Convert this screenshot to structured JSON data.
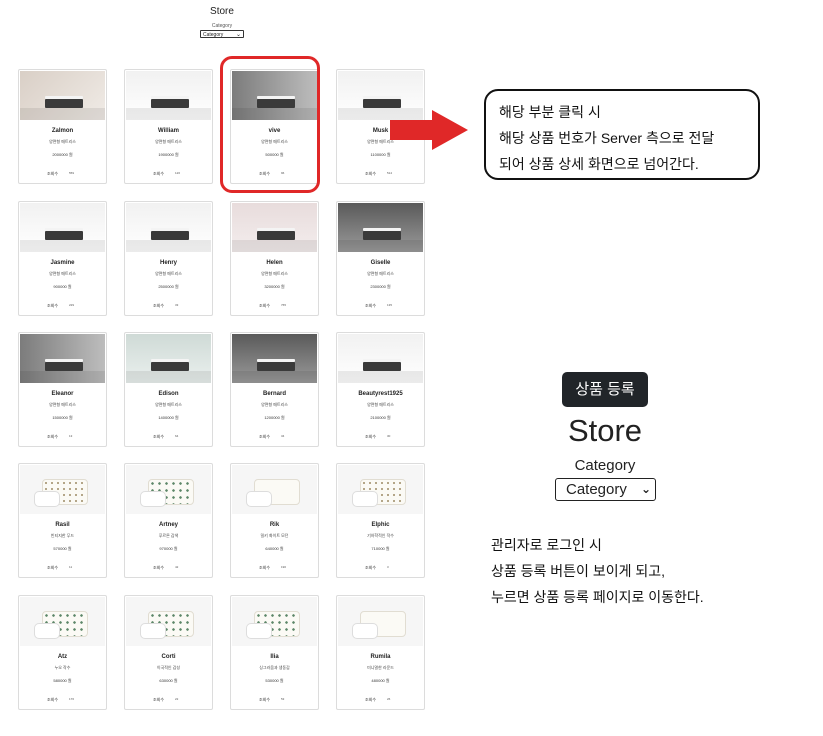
{
  "store_header": {
    "title": "Store",
    "category_label": "Category",
    "category_select": "Category"
  },
  "products": [
    {
      "name": "Zalmon",
      "sub": "양면형 매트리스",
      "price": "2000000 원",
      "views_label": "조회수",
      "views": "559",
      "kind": "mattress",
      "tone": "warm"
    },
    {
      "name": "William",
      "sub": "양면형 매트리스",
      "price": "1900000 원",
      "views_label": "조회수",
      "views": "126",
      "kind": "mattress",
      "tone": "white"
    },
    {
      "name": "vive",
      "sub": "양면형 매트리스",
      "price": "500000 원",
      "views_label": "조회수",
      "views": "96",
      "kind": "mattress",
      "tone": "gray"
    },
    {
      "name": "Musk",
      "sub": "양면형 매트리스",
      "price": "1100000 원",
      "views_label": "조회수",
      "views": "514",
      "kind": "mattress",
      "tone": "white"
    },
    {
      "name": "Jasmine",
      "sub": "양면형 매트리스",
      "price": "900000 원",
      "views_label": "조회수",
      "views": "229",
      "kind": "mattress",
      "tone": "white"
    },
    {
      "name": "Henry",
      "sub": "양면형 매트리스",
      "price": "2500000 원",
      "views_label": "조회수",
      "views": "33",
      "kind": "mattress",
      "tone": "white"
    },
    {
      "name": "Helen",
      "sub": "양면형 매트리스",
      "price": "3200000 원",
      "views_label": "조회수",
      "views": "765",
      "kind": "mattress",
      "tone": "pink"
    },
    {
      "name": "Giselle",
      "sub": "양면형 매트리스",
      "price": "2300000 원",
      "views_label": "조회수",
      "views": "135",
      "kind": "mattress",
      "tone": "dark"
    },
    {
      "name": "Eleanor",
      "sub": "양면형 매트리스",
      "price": "1500000 원",
      "views_label": "조회수",
      "views": "13",
      "kind": "mattress",
      "tone": "gray"
    },
    {
      "name": "Edison",
      "sub": "양면형 매트리스",
      "price": "1400000 원",
      "views_label": "조회수",
      "views": "64",
      "kind": "mattress",
      "tone": "mint"
    },
    {
      "name": "Bernard",
      "sub": "양면형 매트리스",
      "price": "1200000 원",
      "views_label": "조회수",
      "views": "34",
      "kind": "mattress",
      "tone": "dark"
    },
    {
      "name": "Beautyrest1925",
      "sub": "양면형 매트리스",
      "price": "2100000 원",
      "views_label": "조회수",
      "views": "30",
      "kind": "mattress",
      "tone": "white"
    },
    {
      "name": "Rasil",
      "sub": "빈티지한 무드",
      "price": "570000 원",
      "views_label": "조회수",
      "views": "11",
      "kind": "bedding",
      "tone": "dots"
    },
    {
      "name": "Artney",
      "sub": "푸르른 감색",
      "price": "970000 원",
      "views_label": "조회수",
      "views": "42",
      "kind": "bedding",
      "tone": "green"
    },
    {
      "name": "Rik",
      "sub": "밀키 화이트 모던",
      "price": "640000 원",
      "views_label": "조회수",
      "views": "190",
      "kind": "bedding",
      "tone": "plain"
    },
    {
      "name": "Elphic",
      "sub": "기하학적인 작수",
      "price": "710000 원",
      "views_label": "조회수",
      "views": "3",
      "kind": "bedding",
      "tone": "dots"
    },
    {
      "name": "Atz",
      "sub": "누오 작수",
      "price": "580000 원",
      "views_label": "조회수",
      "views": "176",
      "kind": "bedding",
      "tone": "green"
    },
    {
      "name": "Corti",
      "sub": "이국적인 감성",
      "price": "630000 원",
      "views_label": "조회수",
      "views": "22",
      "kind": "bedding",
      "tone": "green"
    },
    {
      "name": "Ilia",
      "sub": "싱그러움과 생동감",
      "price": "530000 원",
      "views_label": "조회수",
      "views": "53",
      "kind": "bedding",
      "tone": "green"
    },
    {
      "name": "Rumila",
      "sub": "미니멀한 라운드",
      "price": "480000 원",
      "views_label": "조회수",
      "views": "26",
      "kind": "bedding",
      "tone": "plain"
    }
  ],
  "callout": {
    "line1": "해당 부분 클릭 시",
    "line2": "해당 상품 번호가 Server 측으로 전달",
    "line3": "되어 상품 상세 화면으로 넘어간다."
  },
  "admin_view": {
    "register_button": "상품 등록",
    "title": "Store",
    "category_label": "Category",
    "category_select": "Category"
  },
  "admin_note": {
    "line1": "관리자로 로그인 시",
    "line2": "상품 등록 버튼이 보이게 되고,",
    "line3": "누르면 상품 등록 페이지로 이동한다."
  },
  "colors": {
    "highlight": "#e02828",
    "arrow": "#e02828",
    "button_bg": "#212529"
  }
}
